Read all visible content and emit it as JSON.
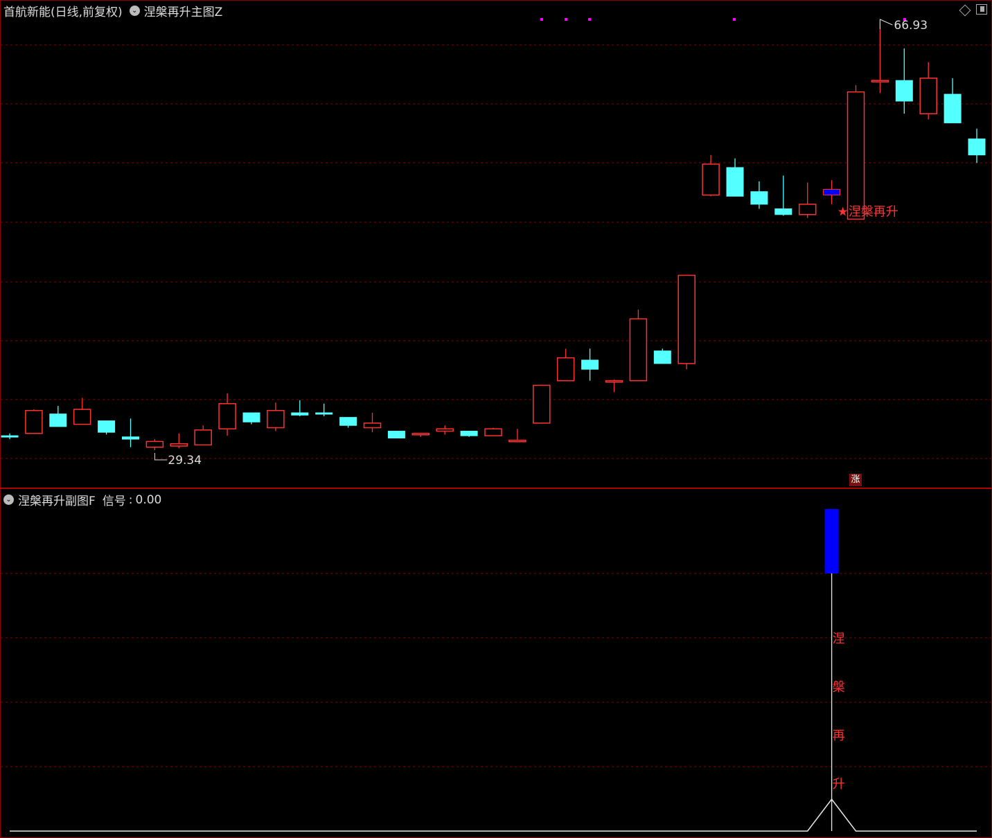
{
  "main_chart": {
    "stock_name": "首航新能(日线,前复权)",
    "indicator_name": "涅槃再升主图Z",
    "high_label": "66.93",
    "low_label": "29.34",
    "signal_label": "涅槃再升",
    "signal_star": "★",
    "badge_label": "涨",
    "colors": {
      "up": "#ff3232",
      "down": "#54ffff",
      "signal": "#0000ff",
      "grid": "#8b0000",
      "marker": "#ff00ff"
    }
  },
  "sub_chart": {
    "indicator_name": "涅槃再升副图F",
    "signal_label": "信号",
    "signal_value": "0.00",
    "vertical_chars": [
      "涅",
      "槃",
      "再",
      "升"
    ]
  },
  "icons": [
    "dropdown-circle-icon",
    "diamond-icon",
    "restore-icon"
  ],
  "chart_data": [
    {
      "type": "candlestick",
      "title": "首航新能(日线,前复权)",
      "annotations": [
        "66.93",
        "29.34",
        "★涅槃再升",
        "涨"
      ],
      "series": [
        {
          "name": "K",
          "ohlc": [
            [
              30.6,
              30.8,
              30.3,
              30.5
            ],
            [
              30.8,
              32.9,
              30.8,
              32.8
            ],
            [
              32.5,
              33.2,
              31.9,
              31.4
            ],
            [
              31.6,
              33.9,
              31.6,
              32.9
            ],
            [
              31.9,
              31.9,
              30.7,
              30.9
            ],
            [
              30.5,
              32.1,
              29.6,
              30.3
            ],
            [
              29.6,
              30.3,
              29.34,
              30.1
            ],
            [
              29.7,
              30.8,
              29.5,
              29.9
            ],
            [
              29.8,
              31.5,
              29.8,
              31.1
            ],
            [
              31.2,
              34.3,
              30.6,
              33.4
            ],
            [
              32.6,
              32.6,
              31.6,
              31.8
            ],
            [
              31.3,
              33.5,
              31.0,
              32.8
            ],
            [
              32.6,
              33.7,
              32.3,
              32.4
            ],
            [
              32.6,
              33.4,
              32.3,
              32.5
            ],
            [
              32.2,
              32.2,
              31.3,
              31.5
            ],
            [
              31.3,
              32.6,
              30.9,
              31.7
            ],
            [
              31.0,
              31.0,
              30.4,
              30.4
            ],
            [
              30.7,
              30.8,
              30.5,
              30.8
            ],
            [
              31.0,
              31.5,
              30.7,
              31.2
            ],
            [
              31.0,
              31.0,
              30.5,
              30.6
            ],
            [
              30.6,
              31.3,
              30.6,
              31.2
            ],
            [
              30.2,
              31.2,
              30.2,
              30.2
            ],
            [
              31.7,
              35.0,
              31.7,
              35.0
            ],
            [
              35.4,
              38.2,
              35.4,
              37.4
            ],
            [
              37.2,
              38.2,
              35.4,
              36.4
            ],
            [
              35.4,
              35.5,
              34.4,
              35.4
            ],
            [
              35.4,
              41.6,
              35.4,
              40.8
            ],
            [
              38.0,
              38.2,
              36.9,
              36.9
            ],
            [
              36.9,
              43.0,
              36.4,
              44.6
            ],
            [
              51.6,
              55.1,
              51.5,
              54.3
            ],
            [
              54.0,
              54.8,
              51.9,
              51.5
            ],
            [
              51.9,
              52.8,
              50.4,
              50.8
            ],
            [
              50.4,
              53.3,
              49.8,
              49.9
            ],
            [
              49.9,
              52.7,
              49.6,
              50.8
            ],
            [
              51.6,
              52.9,
              50.8,
              52.1
            ],
            [
              49.5,
              61.2,
              49.5,
              60.6
            ],
            [
              61.6,
              66.93,
              60.5,
              61.6
            ],
            [
              61.6,
              64.4,
              58.7,
              59.8
            ],
            [
              58.7,
              63.2,
              58.2,
              61.8
            ],
            [
              60.4,
              61.8,
              57.9,
              57.9
            ],
            [
              56.5,
              57.4,
              54.4,
              55.1
            ]
          ]
        }
      ],
      "signal_index": 34,
      "ylim": [
        27.5,
        69.0
      ]
    },
    {
      "type": "line",
      "title": "涅槃再升副图F",
      "series": [
        {
          "name": "信号",
          "values": [
            0,
            0,
            0,
            0,
            0,
            0,
            0,
            0,
            0,
            0,
            0,
            0,
            0,
            0,
            0,
            0,
            0,
            0,
            0,
            0,
            0,
            0,
            0,
            0,
            0,
            0,
            0,
            0,
            0,
            0,
            0,
            0,
            0,
            0,
            1,
            0,
            0,
            0,
            0,
            0,
            0
          ]
        }
      ],
      "ylim": [
        0,
        1
      ]
    }
  ]
}
